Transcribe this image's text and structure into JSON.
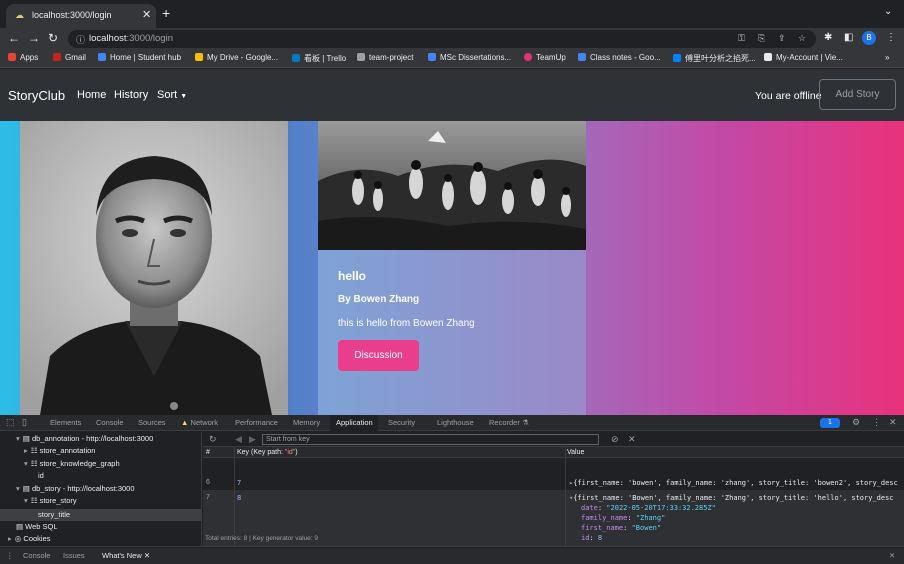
{
  "browser": {
    "tab_title": "localhost:3000/login",
    "url_host": "localhost",
    "url_rest": ":3000/login",
    "bookmarks": [
      "Apps",
      "Gmail",
      "Home | Student hub",
      "My Drive - Google...",
      "看板 | Trello",
      "team-project",
      "MSc Dissertations...",
      "TeamUp",
      "Class notes - Goo...",
      "傅里叶分析之掐死...",
      "My-Account | Vie..."
    ],
    "profile_initial": "B",
    "overflow": "»"
  },
  "navbar": {
    "brand": "StoryClub",
    "links": [
      "Home",
      "History",
      "Sort"
    ],
    "status": "You are offline",
    "add_story": "Add Story"
  },
  "story_card": {
    "title": "hello",
    "author": "By Bowen Zhang",
    "text": "this is hello from Bowen Zhang",
    "button": "Discussion"
  },
  "devtools": {
    "tabs": [
      "Elements",
      "Console",
      "Sources",
      "Network",
      "Performance",
      "Memory",
      "Application",
      "Security",
      "Lighthouse",
      "Recorder"
    ],
    "active_tab": "Application",
    "issues_count": "1",
    "tree": [
      "db_annotation - http://localhost:3000",
      "store_annotation",
      "store_knowledge_graph",
      "id",
      "db_story - http://localhost:3000",
      "store_story",
      "story_title",
      "Web SQL",
      "Cookies"
    ],
    "start_key_placeholder": "Start from key",
    "col_hash": "#",
    "col_key": "Key (Key path: ",
    "col_key_path": "\"id\"",
    "col_key_close": ")",
    "col_value": "Value",
    "rows": [
      {
        "index": "6",
        "key": "7",
        "value": "{first_name: 'bowen', family_name: 'zhang', story_title: 'bowen2', story_desc"
      },
      {
        "index": "7",
        "key": "8",
        "value": "{first_name: 'Bowen', family_name: 'Zhang', story_title: 'hello', story_desc",
        "props": [
          {
            "name": "date",
            "val": "\"2022-05-20T17:33:32.285Z\""
          },
          {
            "name": "family_name",
            "val": "\"Zhang\""
          },
          {
            "name": "first_name",
            "val": "\"Bowen\""
          },
          {
            "name": "id",
            "val": "8"
          }
        ]
      }
    ],
    "total": "Total entries: 8 | Key generator value: 9",
    "drawer_tabs": [
      "Console",
      "Issues",
      "What's New"
    ]
  },
  "colors": {
    "accent_pink": "#e83e8c",
    "navbar_bg": "#2e3135"
  }
}
